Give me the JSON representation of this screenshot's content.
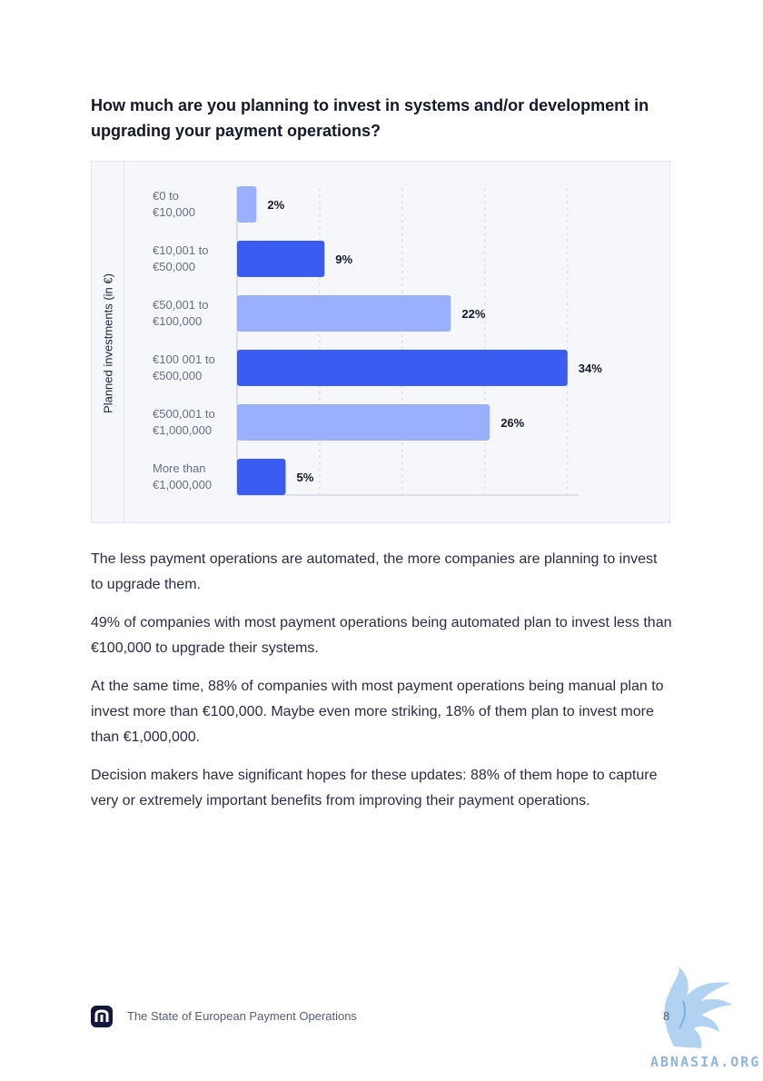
{
  "question": "How much are you planning to invest in systems and/or development in upgrading your payment operations?",
  "chart_data": {
    "type": "bar",
    "orientation": "horizontal",
    "ylabel": "Planned investments (in €)",
    "categories": [
      [
        "€0 to",
        "€10,000"
      ],
      [
        "€10,001  to",
        "€50,000"
      ],
      [
        "€50,001  to",
        "€100,000"
      ],
      [
        "€100 001 to",
        "€500,000"
      ],
      [
        "€500,001 to",
        "€1,000,000"
      ],
      [
        "More than",
        "€1,000,000"
      ]
    ],
    "values": [
      2,
      9,
      22,
      34,
      26,
      5
    ],
    "value_labels": [
      "2%",
      "9%",
      "22%",
      "34%",
      "26%",
      "5%"
    ],
    "bar_colors": [
      "#9bb0fc",
      "#3a5cf0",
      "#9bb0fc",
      "#3a5cf0",
      "#9bb0fc",
      "#3a5cf0"
    ],
    "xlim": [
      0,
      34
    ],
    "grid": "vertical dashed"
  },
  "paragraphs": [
    "The less payment operations are automated, the more companies are planning to invest to upgrade them.",
    "49% of companies with most payment operations being automated plan to invest less than €100,000 to upgrade their systems.",
    "At the same time, 88% of companies with most payment operations being manual plan to invest more than €100,000. Maybe even more striking, 18% of them plan to invest more than €1,000,000.",
    "Decision makers have significant hopes for these updates: 88% of them hope to capture very or extremely important benefits from improving their payment operations."
  ],
  "footer": {
    "title": "The State of European Payment Operations",
    "page_number": "8",
    "watermark": "ABNASIA.ORG"
  },
  "colors": {
    "bar_light": "#9bb0fc",
    "bar_dark": "#3a5cf0",
    "chart_bg": "#f6f7fb",
    "logo": "#14163a"
  },
  "icons": [
    "brand-logo-icon",
    "griffin-watermark-icon"
  ]
}
